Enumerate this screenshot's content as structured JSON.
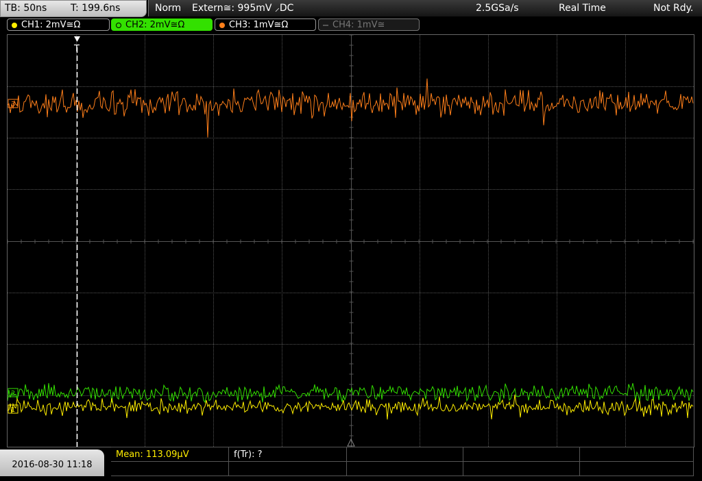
{
  "topbar": {
    "timebase": "TB: 50ns",
    "trigger_time": "T: 199.6ns",
    "trigger_mode": "Norm",
    "trigger_source": "Extern≅: 995mV ⸝DC",
    "sample_rate": "2.5GSa/s",
    "acq_mode": "Real Time",
    "status": "Not Rdy."
  },
  "channels": [
    {
      "label": "CH1: 2mV≅Ω",
      "color": "#ffee00",
      "state": "on"
    },
    {
      "label": "CH2: 2mV≅Ω",
      "color": "#33e000",
      "state": "selected"
    },
    {
      "label": "CH3: 1mV≅Ω",
      "color": "#ff7f1a",
      "state": "on"
    },
    {
      "label": "CH4: 1mV≅",
      "color": "#777777",
      "state": "off"
    }
  ],
  "markers": {
    "trigger_marker": "T",
    "ch1_marker": "1",
    "ch2_marker": "2",
    "ch3_marker": "3"
  },
  "measurements": {
    "mean": "Mean: 113.09µV",
    "rise": "f(Tr): ?"
  },
  "datetime": "2016-08-30 11:18",
  "colors": {
    "ch1": "#ffee00",
    "ch2": "#33e000",
    "ch3": "#ff7f1a",
    "grid": "#555555",
    "trigger_line": "#ffffff"
  },
  "icons": [
    "trigger-t-icon",
    "center-triangle-icon"
  ]
}
